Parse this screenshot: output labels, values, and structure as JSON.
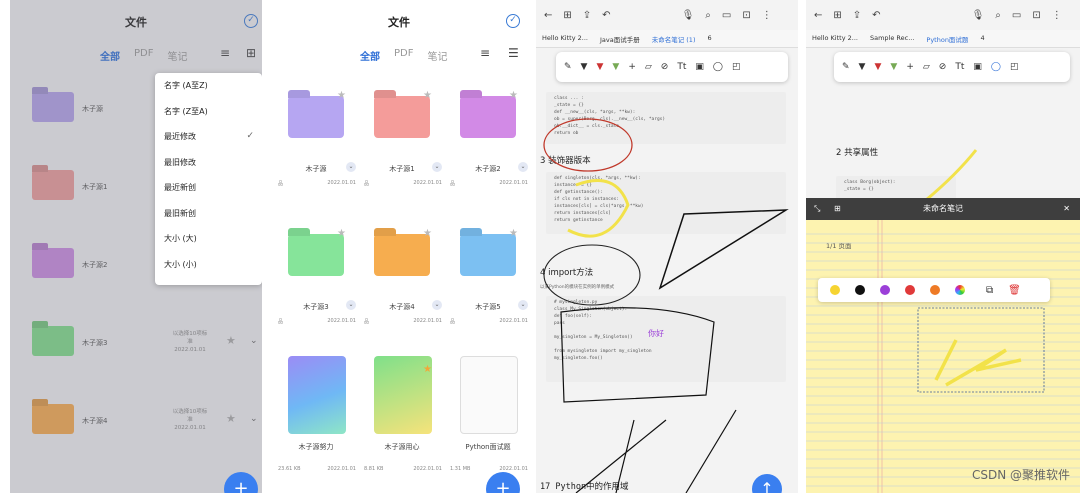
{
  "p1": {
    "title": "文件",
    "tabs": [
      "全部",
      "PDF",
      "笔记"
    ],
    "rows": [
      {
        "name": "木子源",
        "color": "#b0a0e6"
      },
      {
        "name": "木子源1",
        "color": "#e89a9a"
      },
      {
        "name": "木子源2",
        "color": "#c68ade"
      },
      {
        "name": "木子源3",
        "color": "#7fd88a"
      },
      {
        "name": "木子源4",
        "color": "#f2a84f"
      }
    ],
    "row_meta_lines": [
      "以选择10项标",
      "准",
      "2022.01.01"
    ],
    "menu": [
      "名字 (A至Z)",
      "名字 (Z至A)",
      "最近修改",
      "最旧修改",
      "最近新创",
      "最旧新创",
      "大小 (大)",
      "大小 (小)"
    ],
    "checked_index": 2
  },
  "p2": {
    "title": "文件",
    "tabs": [
      "全部",
      "PDF",
      "笔记"
    ],
    "folders": [
      {
        "name": "木子源",
        "color": "#b6a6f2",
        "meta_left": "品",
        "meta_right": "2022.01.01"
      },
      {
        "name": "木子源1",
        "color": "#f49c9a",
        "meta_left": "品",
        "meta_right": "2022.01.01"
      },
      {
        "name": "木子源2",
        "color": "#d28ae6",
        "meta_left": "品",
        "meta_right": "2022.01.01"
      },
      {
        "name": "木子源3",
        "color": "#86e49a",
        "meta_left": "品",
        "meta_right": "2022.01.01"
      },
      {
        "name": "木子源4",
        "color": "#f6ad4f",
        "meta_left": "品",
        "meta_right": "2022.01.01"
      },
      {
        "name": "木子源5",
        "color": "#7cc0f2",
        "meta_left": "品",
        "meta_right": "2022.01.01"
      }
    ],
    "notebooks": [
      {
        "name": "木子源努力",
        "meta_left": "23.61 KB",
        "meta_right": "2022.01.01"
      },
      {
        "name": "木子源用心",
        "meta_left": "8.81 KB",
        "meta_right": "2022.01.01"
      },
      {
        "name": "Python面试题",
        "meta_left": "1.31 MB",
        "meta_right": "2022.01.01"
      }
    ]
  },
  "p3": {
    "tabs": [
      "Hello Kitty 2...",
      "Java面试手册",
      "未命名笔记 (1)",
      "6"
    ],
    "heading3": "3 装饰器版本",
    "heading4": "4 import方法",
    "heading17": "17 Python中的作用域",
    "note_text": "你好",
    "intro_text": "以某Python的模块在实例的单例模式"
  },
  "p4": {
    "tabs": [
      "Hello Kitty 2...",
      "Sample Rec...",
      "Python面试题",
      "4"
    ],
    "heading": "2 共享属性",
    "notepad_title": "未命名笔记",
    "page_label": "1/1 页面",
    "colors": [
      "#f6d431",
      "#111111",
      "#9b3fd8",
      "#e03a3a",
      "#ee7a26"
    ]
  },
  "watermark": "CSDN @聚推软件"
}
